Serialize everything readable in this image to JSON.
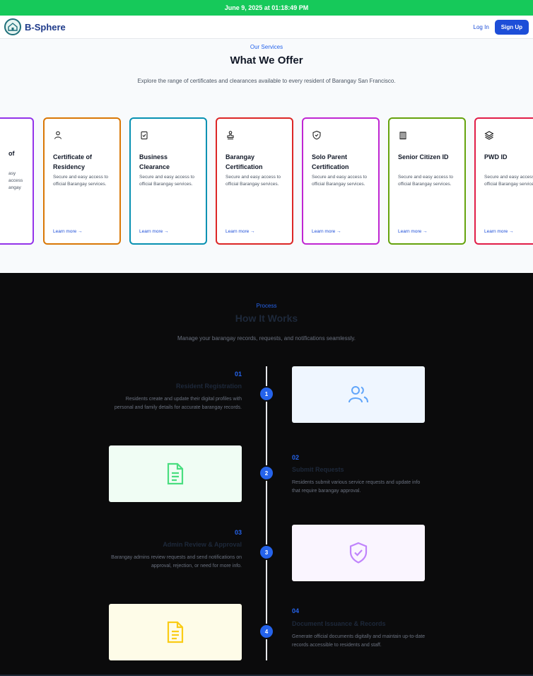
{
  "topbar": {
    "datetime": "June 9, 2025 at 01:18:49 PM"
  },
  "nav": {
    "brand": "B-Sphere",
    "login": "Log In",
    "signup": "Sign Up"
  },
  "services": {
    "eyebrow": "Our Services",
    "title": "What We Offer",
    "subtitle": "Explore the range of certificates and clearances available to every resident of Barangay San Francisco.",
    "cards": [
      {
        "title": "of",
        "desc": "asy access\nangay",
        "link": "",
        "color": "#9333ea",
        "icon": "certificate-icon"
      },
      {
        "title": "Certificate of Residency",
        "desc": "Secure and easy access to official Barangay services.",
        "link": "Learn more →",
        "color": "#d97706",
        "icon": "user-icon"
      },
      {
        "title": "Business Clearance",
        "desc": "Secure and easy access to official Barangay services.",
        "link": "Learn more →",
        "color": "#0891b2",
        "icon": "clipboard-check-icon"
      },
      {
        "title": "Barangay Certification",
        "desc": "Secure and easy access to official Barangay services.",
        "link": "Learn more →",
        "color": "#dc2626",
        "icon": "stamp-icon"
      },
      {
        "title": "Solo Parent Certification",
        "desc": "Secure and easy access to official Barangay services.",
        "link": "Learn more →",
        "color": "#c026d3",
        "icon": "shield-check-icon"
      },
      {
        "title": "Senior Citizen ID",
        "desc": "Secure and easy access to official Barangay services.",
        "link": "Learn more →",
        "color": "#65a30d",
        "icon": "building-icon"
      },
      {
        "title": "PWD ID",
        "desc": "Secure and easy access to official Barangay services.",
        "link": "Learn more →",
        "color": "#e11d48",
        "icon": "layers-icon"
      }
    ]
  },
  "process": {
    "eyebrow": "Process",
    "title": "How It Works",
    "subtitle": "Manage your barangay records, requests, and notifications seamlessly.",
    "steps": [
      {
        "num": "01",
        "title": "Resident Registration",
        "desc": "Residents create and update their digital profiles with personal and family details for accurate barangay records.",
        "dot": "1",
        "icon": "users-icon",
        "bg": "#eff6ff",
        "iconColor": "#60a5fa"
      },
      {
        "num": "02",
        "title": "Submit Requests",
        "desc": "Residents submit various service requests and update info that require barangay approval.",
        "dot": "2",
        "icon": "document-icon",
        "bg": "#f0fdf4",
        "iconColor": "#4ade80"
      },
      {
        "num": "03",
        "title": "Admin Review & Approval",
        "desc": "Barangay admins review requests and send notifications on approval, rejection, or need for more info.",
        "dot": "3",
        "icon": "shield-check-icon",
        "bg": "#faf5ff",
        "iconColor": "#c084fc"
      },
      {
        "num": "04",
        "title": "Document Issuance & Records",
        "desc": "Generate official documents digitally and maintain up-to-date records accessible to residents and staff.",
        "dot": "4",
        "icon": "document-icon",
        "bg": "#fefce8",
        "iconColor": "#facc15"
      }
    ]
  }
}
